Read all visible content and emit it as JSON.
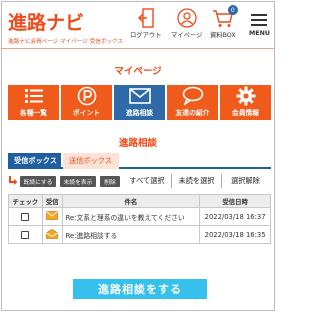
{
  "header": {
    "logo": "進路ナビ",
    "breadcrumb": "進路ナビ会員ページ マイページ 受信ボックス",
    "nav": [
      {
        "label": "ログアウト",
        "icon": "logout-icon"
      },
      {
        "label": "マイページ",
        "icon": "user-icon"
      },
      {
        "label": "資料BOX",
        "icon": "cart-icon",
        "badge": "0"
      },
      {
        "label": "MENU",
        "icon": "hamburger-icon"
      }
    ]
  },
  "mypage": {
    "title": "マイページ",
    "tiles": [
      {
        "label": "各種一覧",
        "icon": "list-icon",
        "active": false
      },
      {
        "label": "ポイント",
        "icon": "points-icon",
        "active": false
      },
      {
        "label": "進路相談",
        "icon": "mail-icon",
        "active": true
      },
      {
        "label": "友達の紹介",
        "icon": "chat-bubble-icon",
        "active": false
      },
      {
        "label": "会員情報",
        "icon": "gear-icon",
        "active": false
      }
    ]
  },
  "consult": {
    "title": "進路相談",
    "tabs": [
      {
        "label": "受信ボックス",
        "active": true
      },
      {
        "label": "送信ボックス",
        "active": false
      }
    ],
    "actions": {
      "mark_read": "既読にする",
      "mark_unread": "未読を表示",
      "delete": "削除",
      "select_all": "すべて選択",
      "select_unread": "未読を選択",
      "deselect": "選択解除"
    },
    "table": {
      "headers": [
        "チェック",
        "受信",
        "件名",
        "受信日時"
      ],
      "rows": [
        {
          "subject": "Re:文系と理系の違いを教えてください",
          "date": "2022/03/18 16:37",
          "read": false
        },
        {
          "subject": "Re:進路相談する",
          "date": "2022/03/18 16:35",
          "read": true
        }
      ]
    },
    "cta": "進路相談をする"
  },
  "colors": {
    "brand": "#f04a18",
    "active_tile": "#2e6aa8",
    "tab_blue": "#1f5f9f",
    "cta": "#35c0ee"
  }
}
